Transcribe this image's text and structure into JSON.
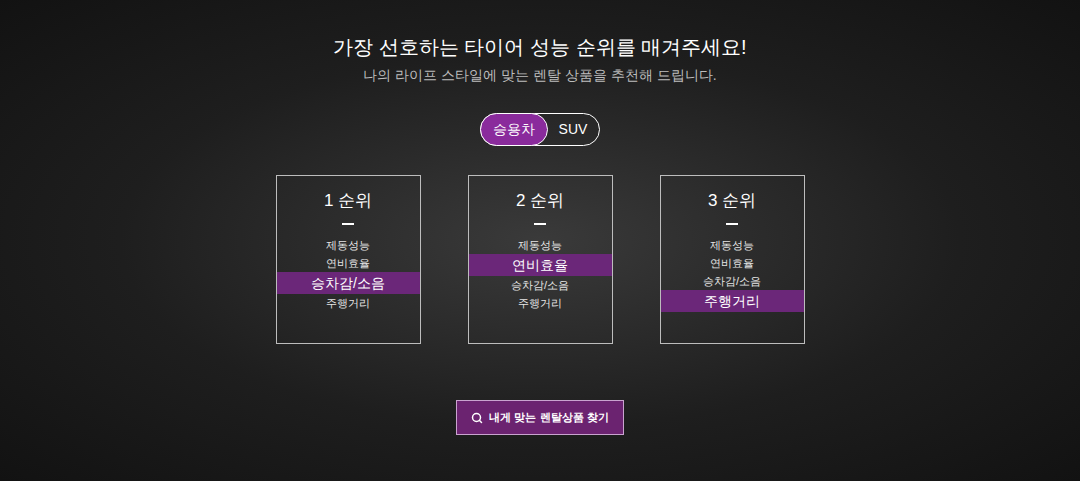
{
  "title": "가장 선호하는 타이어 성능 순위를 매겨주세요!",
  "subtitle": "나의 라이프 스타일에 맞는 렌탈 상품을 추천해 드립니다.",
  "vehicle_tabs": [
    {
      "label": "승용차",
      "selected": true
    },
    {
      "label": "SUV",
      "selected": false
    }
  ],
  "rank_cards": [
    {
      "title": "1 순위",
      "options": [
        {
          "label": "제동성능",
          "selected": false
        },
        {
          "label": "연비효율",
          "selected": false
        },
        {
          "label": "승차감/소음",
          "selected": true
        },
        {
          "label": "주행거리",
          "selected": false
        }
      ]
    },
    {
      "title": "2 순위",
      "options": [
        {
          "label": "제동성능",
          "selected": false
        },
        {
          "label": "연비효율",
          "selected": true
        },
        {
          "label": "승차감/소음",
          "selected": false
        },
        {
          "label": "주행거리",
          "selected": false
        }
      ]
    },
    {
      "title": "3 순위",
      "options": [
        {
          "label": "제동성능",
          "selected": false
        },
        {
          "label": "연비효율",
          "selected": false
        },
        {
          "label": "승차감/소음",
          "selected": false
        },
        {
          "label": "주행거리",
          "selected": true
        }
      ]
    }
  ],
  "search_button": {
    "label": "내게 맞는 렌탈상품 찾기"
  }
}
